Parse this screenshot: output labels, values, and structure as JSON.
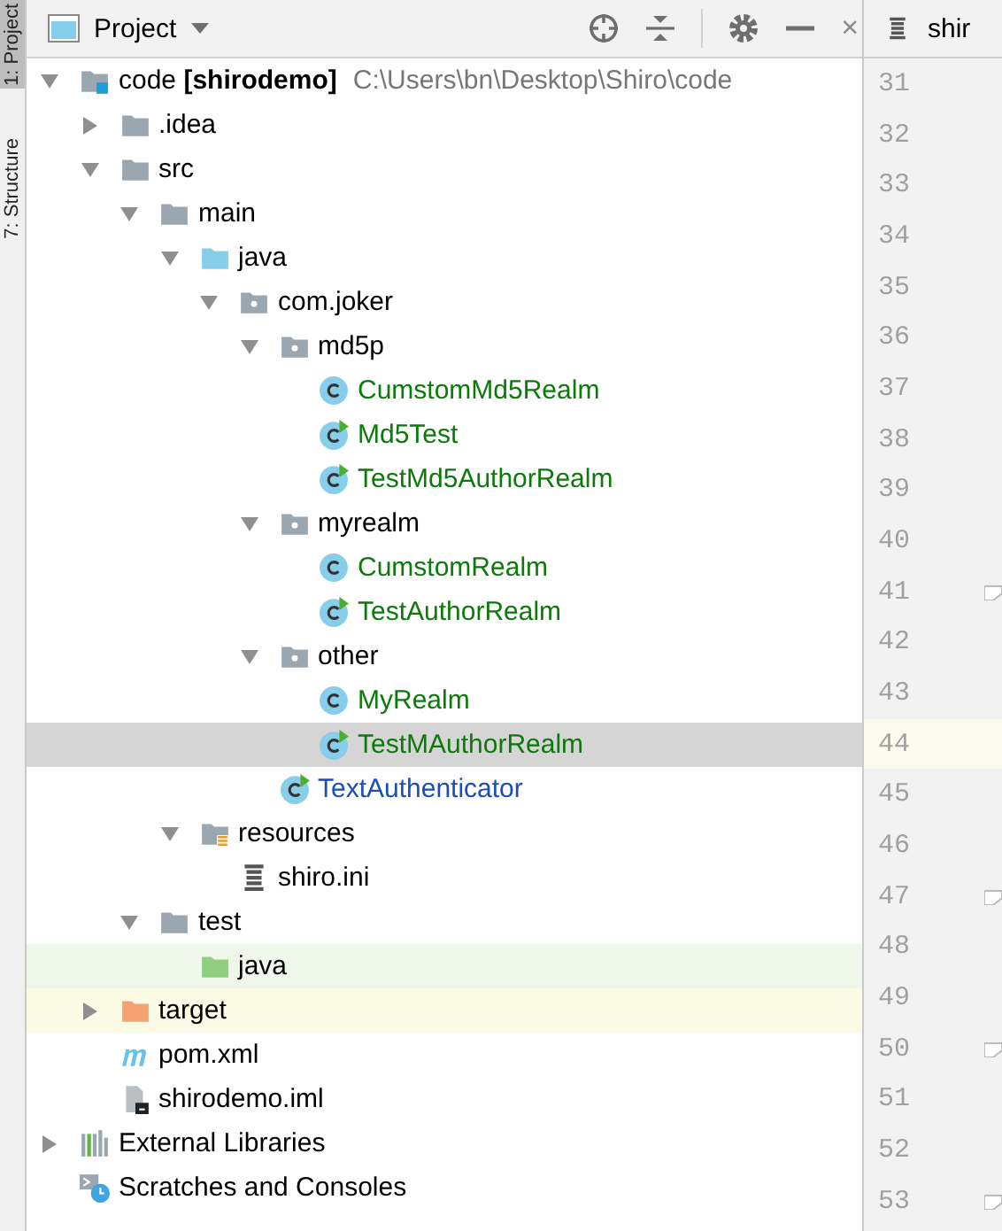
{
  "side_tabs": [
    {
      "label": "1: Project",
      "selected": true
    },
    {
      "label": "7: Structure",
      "selected": false
    }
  ],
  "panel": {
    "title": "Project",
    "close": "×"
  },
  "editor_tab": {
    "label": "shir"
  },
  "tree": [
    {
      "kind": "module",
      "name": "code",
      "module": "[shirodemo]",
      "path": "C:\\Users\\bn\\Desktop\\Shiro\\code",
      "expanded": true,
      "selected": false,
      "children": [
        {
          "kind": "folder",
          "name": ".idea",
          "expanded": false,
          "selected": false
        },
        {
          "kind": "folder",
          "name": "src",
          "expanded": true,
          "selected": false,
          "children": [
            {
              "kind": "folder",
              "name": "main",
              "expanded": true,
              "selected": false,
              "children": [
                {
                  "kind": "source",
                  "name": "java",
                  "expanded": true,
                  "selected": false,
                  "children": [
                    {
                      "kind": "package",
                      "name": "com.joker",
                      "expanded": true,
                      "selected": false,
                      "children": [
                        {
                          "kind": "package",
                          "name": "md5p",
                          "expanded": true,
                          "selected": false,
                          "children": [
                            {
                              "kind": "class",
                              "name": "CumstomMd5Realm",
                              "color": "#0b7a0b",
                              "selected": false
                            },
                            {
                              "kind": "test-class",
                              "name": "Md5Test",
                              "color": "#0b7a0b",
                              "selected": false
                            },
                            {
                              "kind": "test-class",
                              "name": "TestMd5AuthorRealm",
                              "color": "#0b7a0b",
                              "selected": false
                            }
                          ]
                        },
                        {
                          "kind": "package",
                          "name": "myrealm",
                          "expanded": true,
                          "selected": false,
                          "children": [
                            {
                              "kind": "class",
                              "name": "CumstomRealm",
                              "color": "#0b7a0b",
                              "selected": false
                            },
                            {
                              "kind": "test-class",
                              "name": "TestAuthorRealm",
                              "color": "#0b7a0b",
                              "selected": false
                            }
                          ]
                        },
                        {
                          "kind": "package",
                          "name": "other",
                          "expanded": true,
                          "selected": false,
                          "children": [
                            {
                              "kind": "class",
                              "name": "MyRealm",
                              "color": "#0b7a0b",
                              "selected": false
                            },
                            {
                              "kind": "test-class",
                              "name": "TestMAuthorRealm",
                              "color": "#0b7a0b",
                              "selected": true
                            }
                          ]
                        },
                        {
                          "kind": "test-class",
                          "name": "TextAuthenticator",
                          "color": "#1b4dbb",
                          "selected": false
                        }
                      ]
                    }
                  ]
                },
                {
                  "kind": "resources",
                  "name": "resources",
                  "expanded": true,
                  "selected": false,
                  "children": [
                    {
                      "kind": "ini",
                      "name": "shiro.ini",
                      "selected": false
                    }
                  ]
                }
              ]
            },
            {
              "kind": "folder",
              "name": "test",
              "expanded": true,
              "selected": false,
              "children": [
                {
                  "kind": "test-root",
                  "name": "java",
                  "test_source": true,
                  "selected": false
                }
              ]
            }
          ]
        },
        {
          "kind": "excluded",
          "name": "target",
          "excluded": true,
          "expanded": false,
          "selected": false
        },
        {
          "kind": "maven",
          "name": "pom.xml",
          "selected": false
        },
        {
          "kind": "iml",
          "name": "shirodemo.iml",
          "selected": false
        }
      ]
    },
    {
      "kind": "libraries",
      "name": "External Libraries",
      "expanded": false,
      "selected": false
    },
    {
      "kind": "scratches",
      "name": "Scratches and Consoles",
      "selected": false
    }
  ],
  "gutter": [
    {
      "number": "31",
      "current": false,
      "fold": false
    },
    {
      "number": "32",
      "current": false,
      "fold": false
    },
    {
      "number": "33",
      "current": false,
      "fold": false
    },
    {
      "number": "34",
      "current": false,
      "fold": false
    },
    {
      "number": "35",
      "current": false,
      "fold": false
    },
    {
      "number": "36",
      "current": false,
      "fold": false
    },
    {
      "number": "37",
      "current": false,
      "fold": false
    },
    {
      "number": "38",
      "current": false,
      "fold": false
    },
    {
      "number": "39",
      "current": false,
      "fold": false
    },
    {
      "number": "40",
      "current": false,
      "fold": false
    },
    {
      "number": "41",
      "current": false,
      "fold": true
    },
    {
      "number": "42",
      "current": false,
      "fold": false
    },
    {
      "number": "43",
      "current": false,
      "fold": false
    },
    {
      "number": "44",
      "current": true,
      "fold": false
    },
    {
      "number": "45",
      "current": false,
      "fold": false
    },
    {
      "number": "46",
      "current": false,
      "fold": false
    },
    {
      "number": "47",
      "current": false,
      "fold": true
    },
    {
      "number": "48",
      "current": false,
      "fold": false
    },
    {
      "number": "49",
      "current": false,
      "fold": false
    },
    {
      "number": "50",
      "current": false,
      "fold": true
    },
    {
      "number": "51",
      "current": false,
      "fold": false
    },
    {
      "number": "52",
      "current": false,
      "fold": false
    },
    {
      "number": "53",
      "current": false,
      "fold": true
    }
  ]
}
